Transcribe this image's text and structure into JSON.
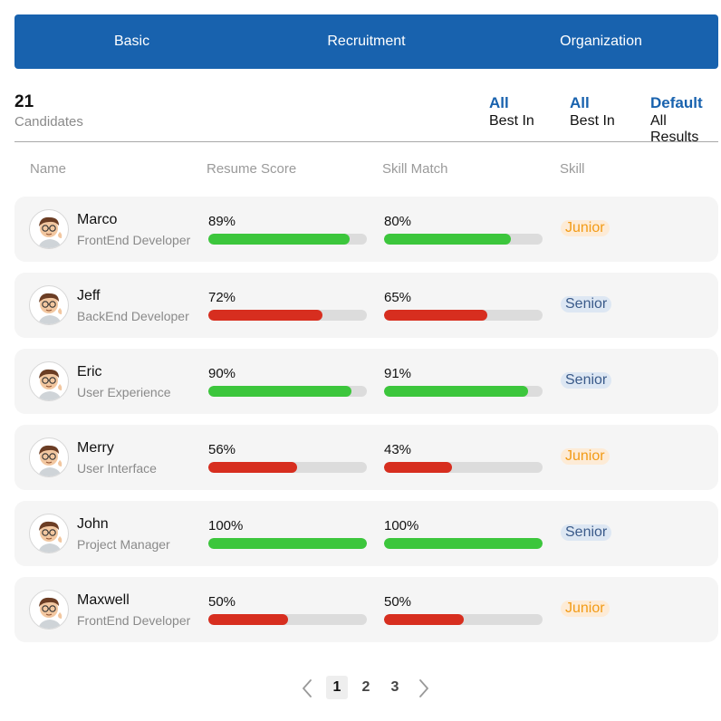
{
  "tabs": [
    {
      "label": "Basic"
    },
    {
      "label": "Recruitment"
    },
    {
      "label": "Organization"
    }
  ],
  "summary": {
    "count": "21",
    "count_label": "Candidates",
    "filters": [
      {
        "value": "All",
        "label": "Best In"
      },
      {
        "value": "All",
        "label": "Best In"
      },
      {
        "value": "Default",
        "label": "All Results"
      }
    ]
  },
  "columns": {
    "name": "Name",
    "resume": "Resume Score",
    "skill": "Skill Match",
    "level": "Skill"
  },
  "colors": {
    "primary": "#1862ae",
    "good": "#3cc63c",
    "bad": "#d72e1f",
    "junior_text": "#f29b16",
    "junior_bg": "#fdebd6",
    "senior_text": "#3b5b8a",
    "senior_bg": "#dde7f3"
  },
  "candidates": [
    {
      "name": "Marco",
      "role": "FrontEnd Developer",
      "resume": "89%",
      "resume_value": 89,
      "skill": "80%",
      "skill_value": 80,
      "level": "Junior",
      "status": "good"
    },
    {
      "name": "Jeff",
      "role": "BackEnd Developer",
      "resume": "72%",
      "resume_value": 72,
      "skill": "65%",
      "skill_value": 65,
      "level": "Senior",
      "status": "bad"
    },
    {
      "name": "Eric",
      "role": "User Experience",
      "resume": "90%",
      "resume_value": 90,
      "skill": "91%",
      "skill_value": 91,
      "level": "Senior",
      "status": "good"
    },
    {
      "name": "Merry",
      "role": "User Interface",
      "resume": "56%",
      "resume_value": 56,
      "skill": "43%",
      "skill_value": 43,
      "level": "Junior",
      "status": "bad"
    },
    {
      "name": "John",
      "role": "Project Manager",
      "resume": "100%",
      "resume_value": 100,
      "skill": "100%",
      "skill_value": 100,
      "level": "Senior",
      "status": "good"
    },
    {
      "name": "Maxwell",
      "role": "FrontEnd Developer",
      "resume": "50%",
      "resume_value": 50,
      "skill": "50%",
      "skill_value": 50,
      "level": "Junior",
      "status": "bad"
    }
  ],
  "pagination": {
    "pages": [
      "1",
      "2",
      "3"
    ],
    "current": "1"
  },
  "icons": {
    "avatar": "memoji-avatar-icon",
    "prev": "chevron-left-icon",
    "next": "chevron-right-icon"
  }
}
